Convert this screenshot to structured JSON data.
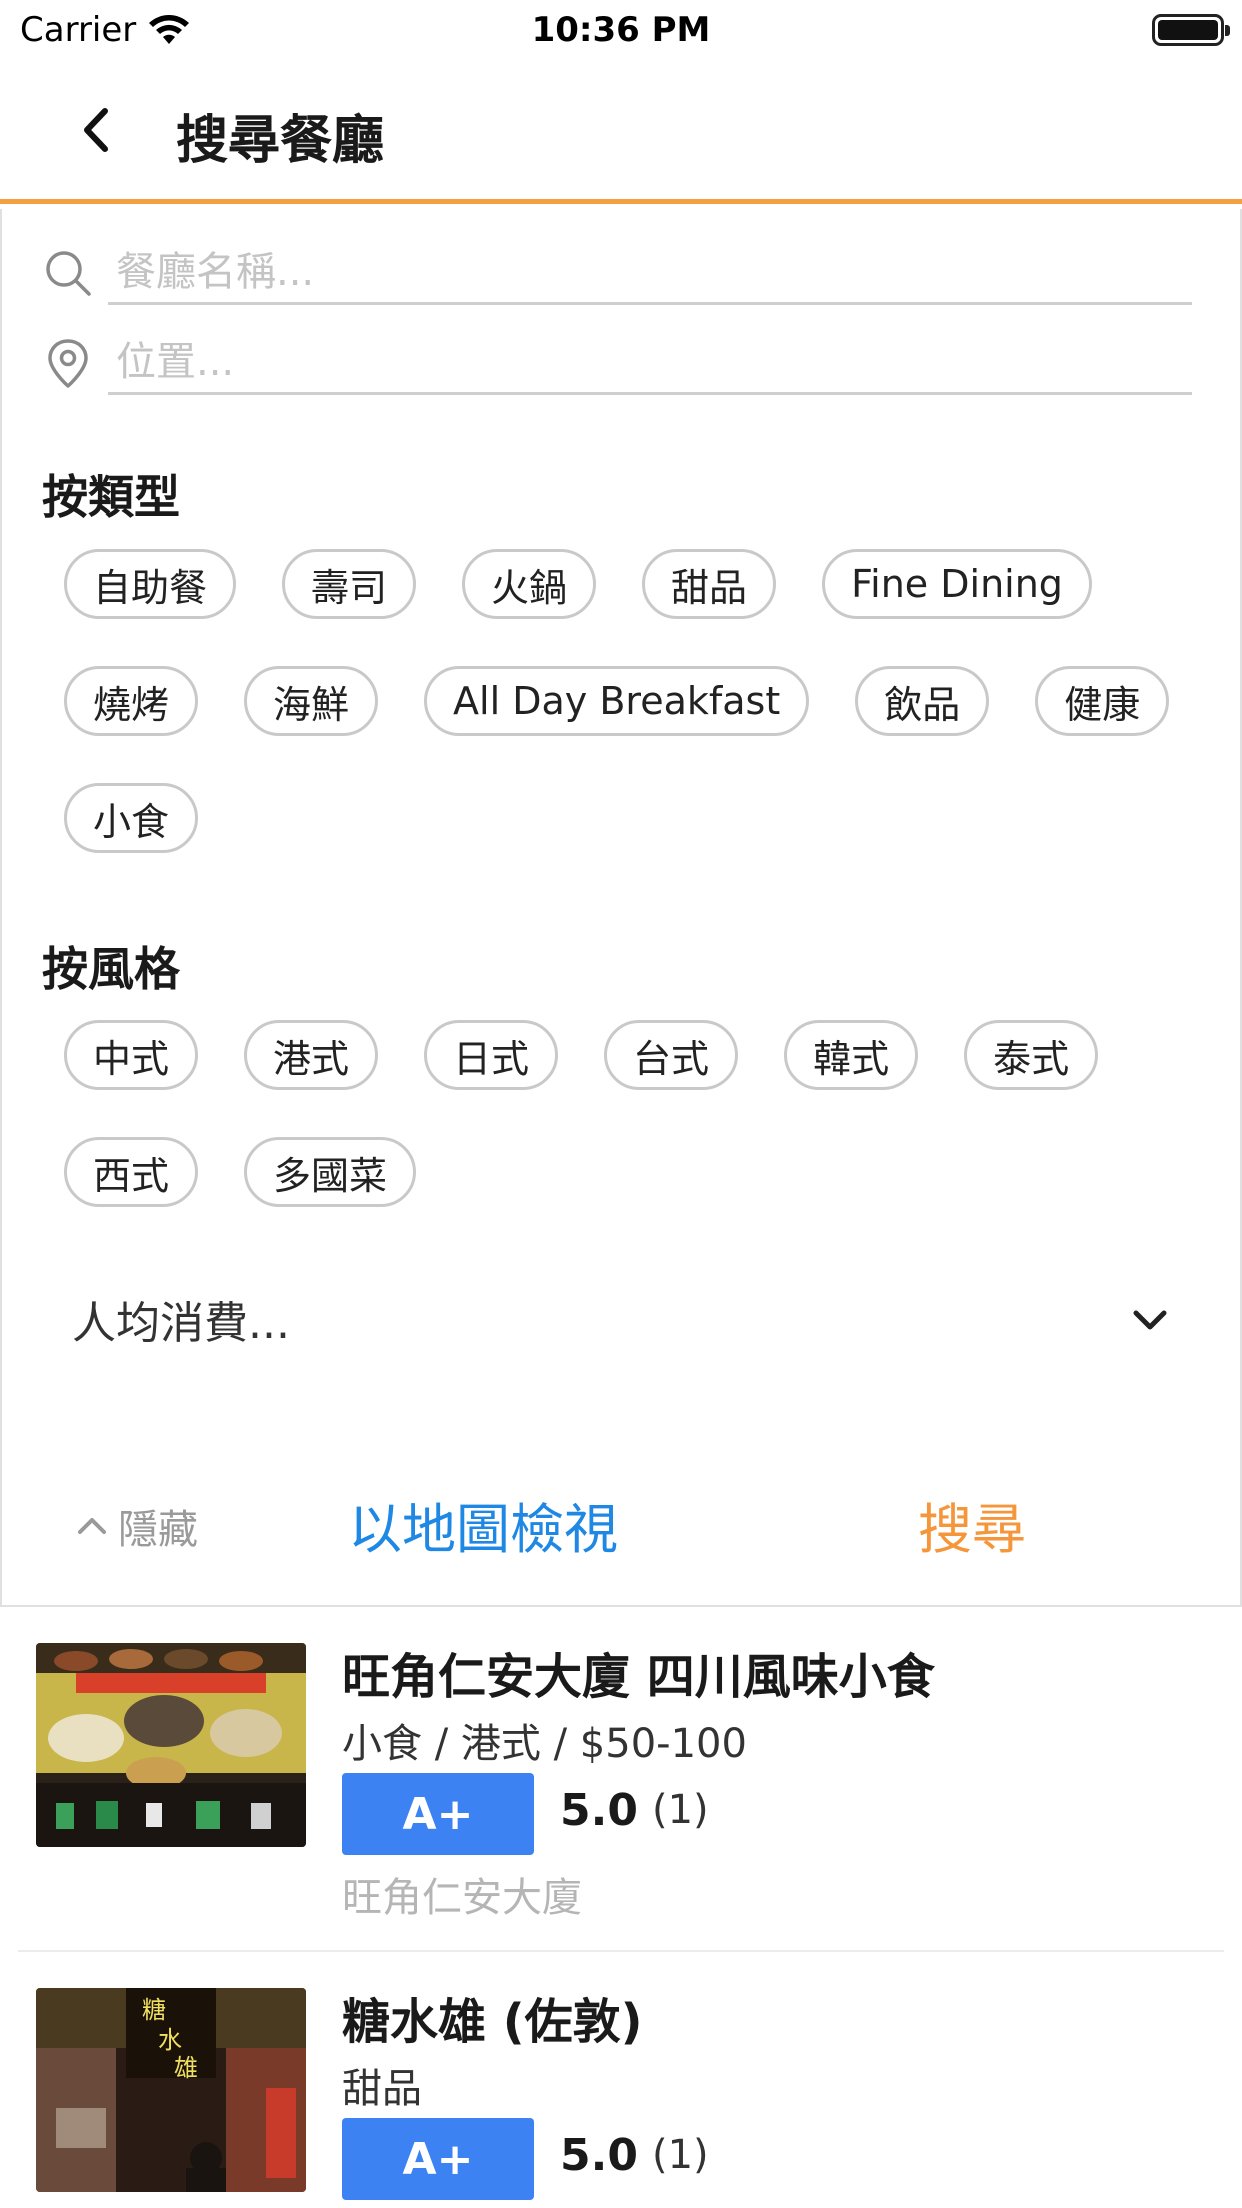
{
  "status_bar": {
    "carrier": "Carrier",
    "time": "10:36 PM"
  },
  "nav": {
    "title": "搜尋餐廳",
    "back_icon": "chevron-left-icon",
    "accent_color": "#f5a043"
  },
  "search": {
    "name_placeholder": "餐廳名稱...",
    "location_placeholder": "位置..."
  },
  "by_type": {
    "title": "按類型",
    "chips": [
      "自助餐",
      "壽司",
      "火鍋",
      "甜品",
      "Fine Dining",
      "燒烤",
      "海鮮",
      "All Day Breakfast",
      "飲品",
      "健康",
      "小食"
    ]
  },
  "by_style": {
    "title": "按風格",
    "chips": [
      "中式",
      "港式",
      "日式",
      "台式",
      "韓式",
      "泰式",
      "西式",
      "多國菜"
    ]
  },
  "price": {
    "label": "人均消費..."
  },
  "actions": {
    "hide_label": "隱藏",
    "map_label": "以地圖檢視",
    "search_label": "搜尋",
    "map_color": "#1f88e5",
    "search_color": "#f5963a"
  },
  "results": [
    {
      "name": "旺角仁安大廈 四川風味小食",
      "meta": "小食 / 港式 / $50-100",
      "grade": "A+",
      "score": "5.0",
      "count": "(1)",
      "building": "旺角仁安大廈"
    },
    {
      "name": "糖水雄 (佐敦)",
      "meta": "甜品",
      "grade": "A+",
      "score": "5.0",
      "count": "(1)",
      "building": ""
    }
  ],
  "grade_color": "#3c82f3"
}
